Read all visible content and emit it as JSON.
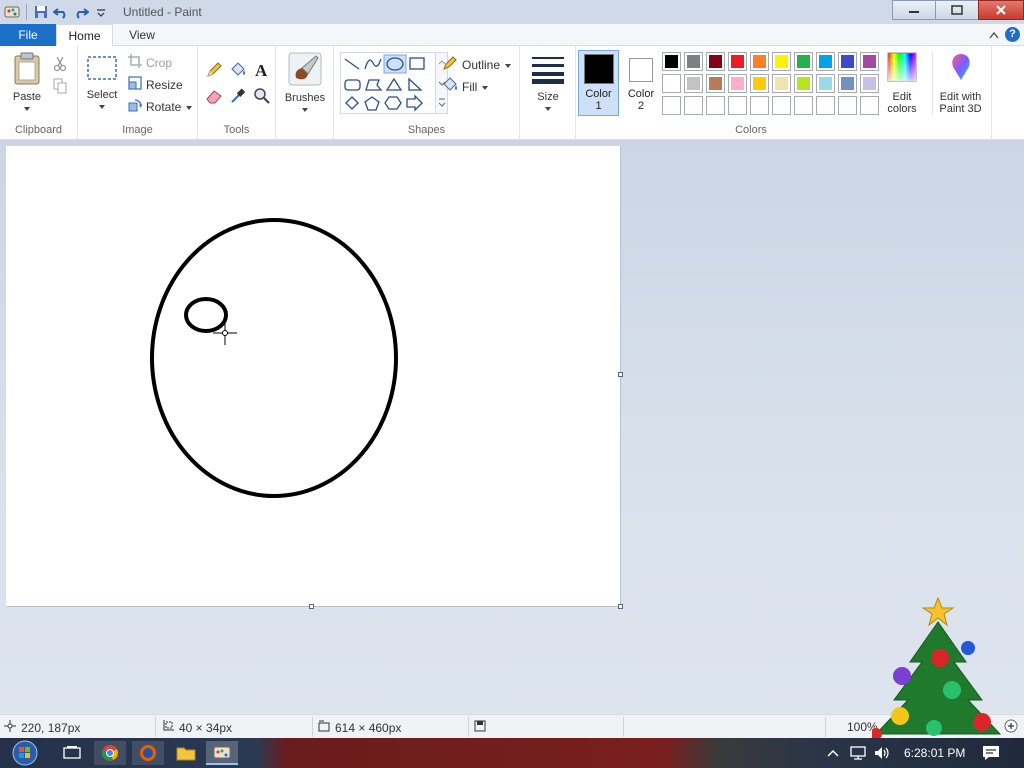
{
  "window": {
    "title": "Untitled - Paint"
  },
  "tabs": {
    "file": "File",
    "home": "Home",
    "view": "View"
  },
  "clipboard": {
    "label": "Clipboard",
    "paste": "Paste"
  },
  "image": {
    "label": "Image",
    "select": "Select",
    "crop": "Crop",
    "resize": "Resize",
    "rotate": "Rotate"
  },
  "tools": {
    "label": "Tools"
  },
  "brushes": {
    "label": "Brushes"
  },
  "shapes": {
    "label": "Shapes",
    "outline": "Outline",
    "fill": "Fill"
  },
  "size": {
    "label": "Size"
  },
  "colors": {
    "label": "Colors",
    "color1": "Color",
    "color1_num": "1",
    "color2": "Color",
    "color2_num": "2",
    "edit_colors": "Edit",
    "edit_colors_2": "colors",
    "paint3d": "Edit with",
    "paint3d_2": "Paint 3D",
    "color1_value": "#000000",
    "color2_value": "#ffffff",
    "palette_row1": [
      "#000000",
      "#7f7f7f",
      "#880015",
      "#ed1c24",
      "#ff7f27",
      "#fff200",
      "#22b14c",
      "#00a2e8",
      "#3f48cc",
      "#a349a4"
    ],
    "palette_row2": [
      "#ffffff",
      "#c3c3c3",
      "#b97a57",
      "#ffaec9",
      "#ffc90e",
      "#efe4b0",
      "#b5e61d",
      "#99d9ea",
      "#7092be",
      "#c8bfe7"
    ]
  },
  "status": {
    "cursor": "220, 187px",
    "selection": "40 × 34px",
    "canvas_size": "614 × 460px",
    "zoom": "100%"
  },
  "taskbar": {
    "time": "6:28:01 PM"
  }
}
